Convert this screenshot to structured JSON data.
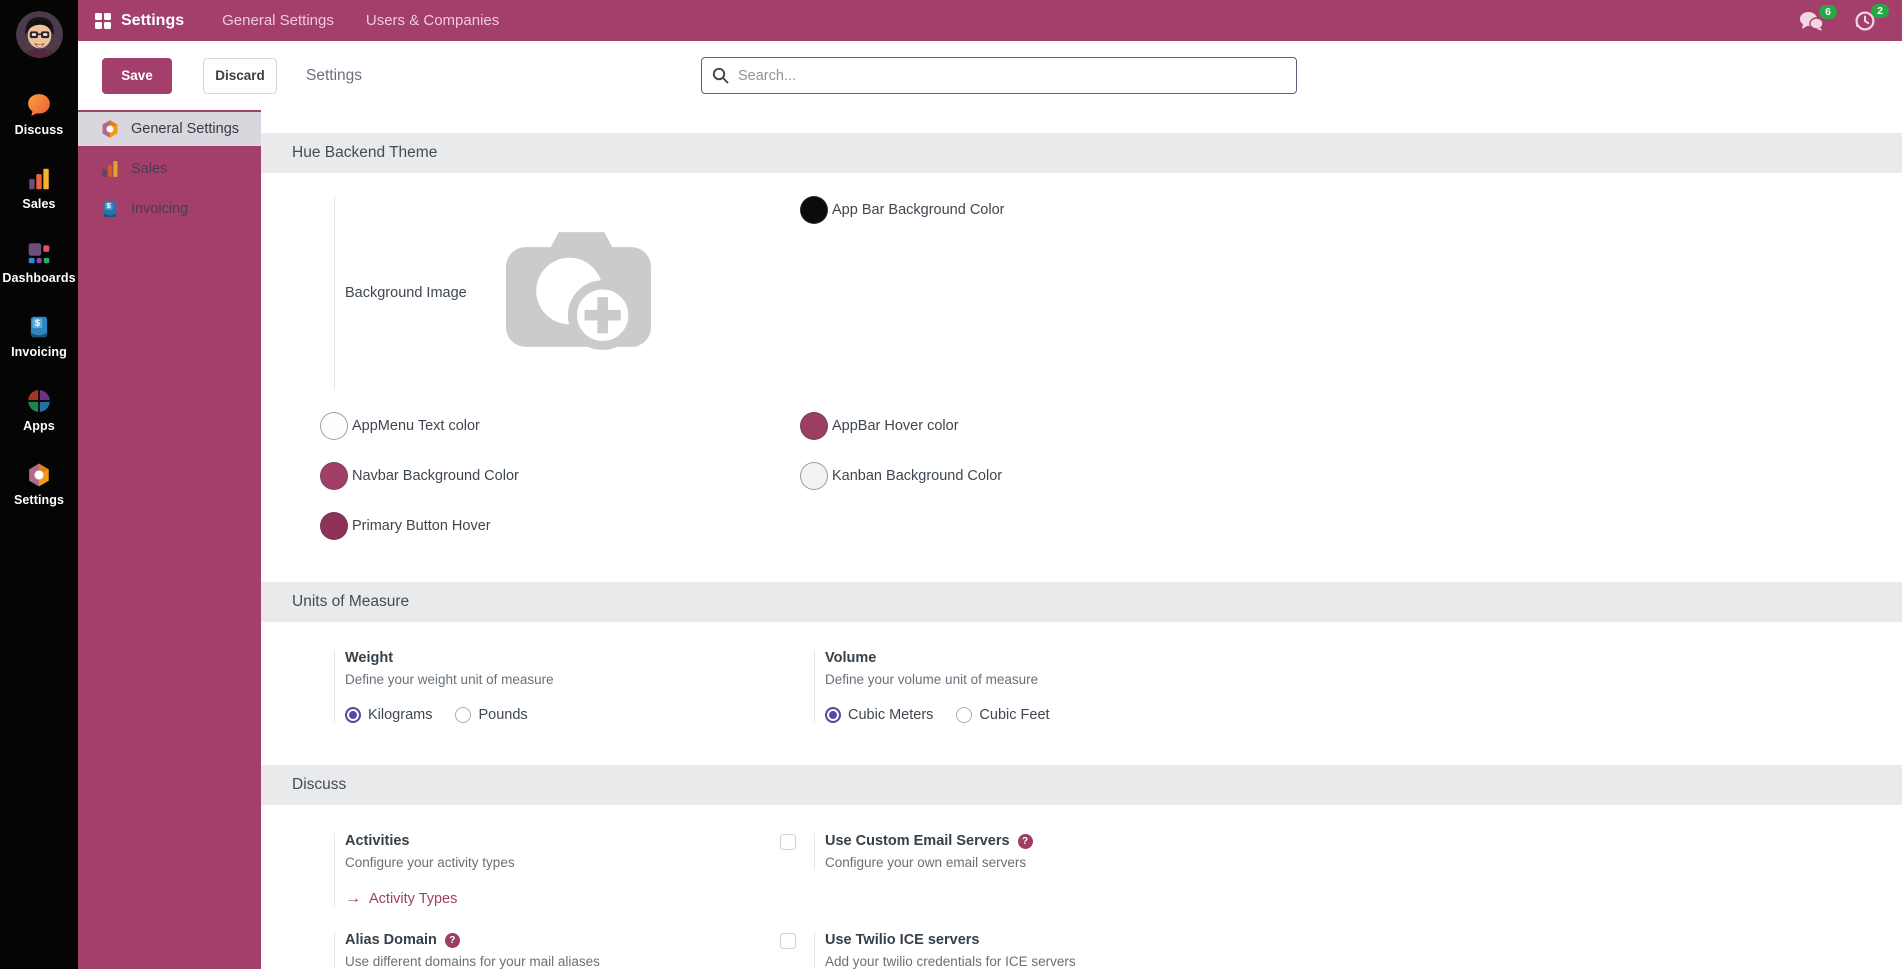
{
  "topbar": {
    "app_title": "Settings",
    "menu_general": "General Settings",
    "menu_users": "Users & Companies",
    "messages_badge": "6",
    "activities_badge": "2"
  },
  "sidebar": {
    "apps": [
      {
        "label": "Discuss"
      },
      {
        "label": "Sales"
      },
      {
        "label": "Dashboards"
      },
      {
        "label": "Invoicing"
      },
      {
        "label": "Apps"
      },
      {
        "label": "Settings"
      }
    ]
  },
  "control_panel": {
    "save_label": "Save",
    "discard_label": "Discard",
    "breadcrumb": "Settings",
    "search_placeholder": "Search..."
  },
  "settings_nav": {
    "items": [
      {
        "label": "General Settings",
        "selected": true
      },
      {
        "label": "Sales",
        "selected": false
      },
      {
        "label": "Invoicing",
        "selected": false
      }
    ]
  },
  "sections": {
    "theme": {
      "title": "Hue Backend Theme",
      "fields": {
        "app_bar_bg": {
          "label": "App Bar Background Color",
          "color": "#0B0B0B"
        },
        "background_image": {
          "label": "Background Image"
        },
        "appmenu_text": {
          "label": "AppMenu Text color",
          "color": "#FDFDFD"
        },
        "appbar_hover": {
          "label": "AppBar Hover color",
          "color": "#9C3D63"
        },
        "navbar_bg": {
          "label": "Navbar Background Color",
          "color": "#A23F68"
        },
        "kanban_bg": {
          "label": "Kanban Background Color",
          "color": "#F3F3F4"
        },
        "primary_button_hover": {
          "label": "Primary Button Hover",
          "color": "#8F3159"
        }
      }
    },
    "uom": {
      "title": "Units of Measure",
      "weight": {
        "title": "Weight",
        "desc": "Define your weight unit of measure",
        "options": [
          "Kilograms",
          "Pounds"
        ],
        "selected": "Kilograms"
      },
      "volume": {
        "title": "Volume",
        "desc": "Define your volume unit of measure",
        "options": [
          "Cubic Meters",
          "Cubic Feet"
        ],
        "selected": "Cubic Meters"
      }
    },
    "discuss": {
      "title": "Discuss",
      "activities": {
        "title": "Activities",
        "desc": "Configure your activity types",
        "link": "Activity Types"
      },
      "custom_email": {
        "title": "Use Custom Email Servers",
        "desc": "Configure your own email servers",
        "help": "?",
        "checked": false
      },
      "alias_domain": {
        "title": "Alias Domain",
        "desc": "Use different domains for your mail aliases",
        "help": "?"
      },
      "twilio": {
        "title": "Use Twilio ICE servers",
        "desc": "Add your twilio credentials for ICE servers",
        "checked": false
      }
    }
  },
  "colors": {
    "brand": "#A43E6B",
    "badge_green": "#28A745",
    "radio_accent": "#584A9E",
    "section_band": "#E9EAEB",
    "selected_nav_bg": "#D9D6DE"
  }
}
